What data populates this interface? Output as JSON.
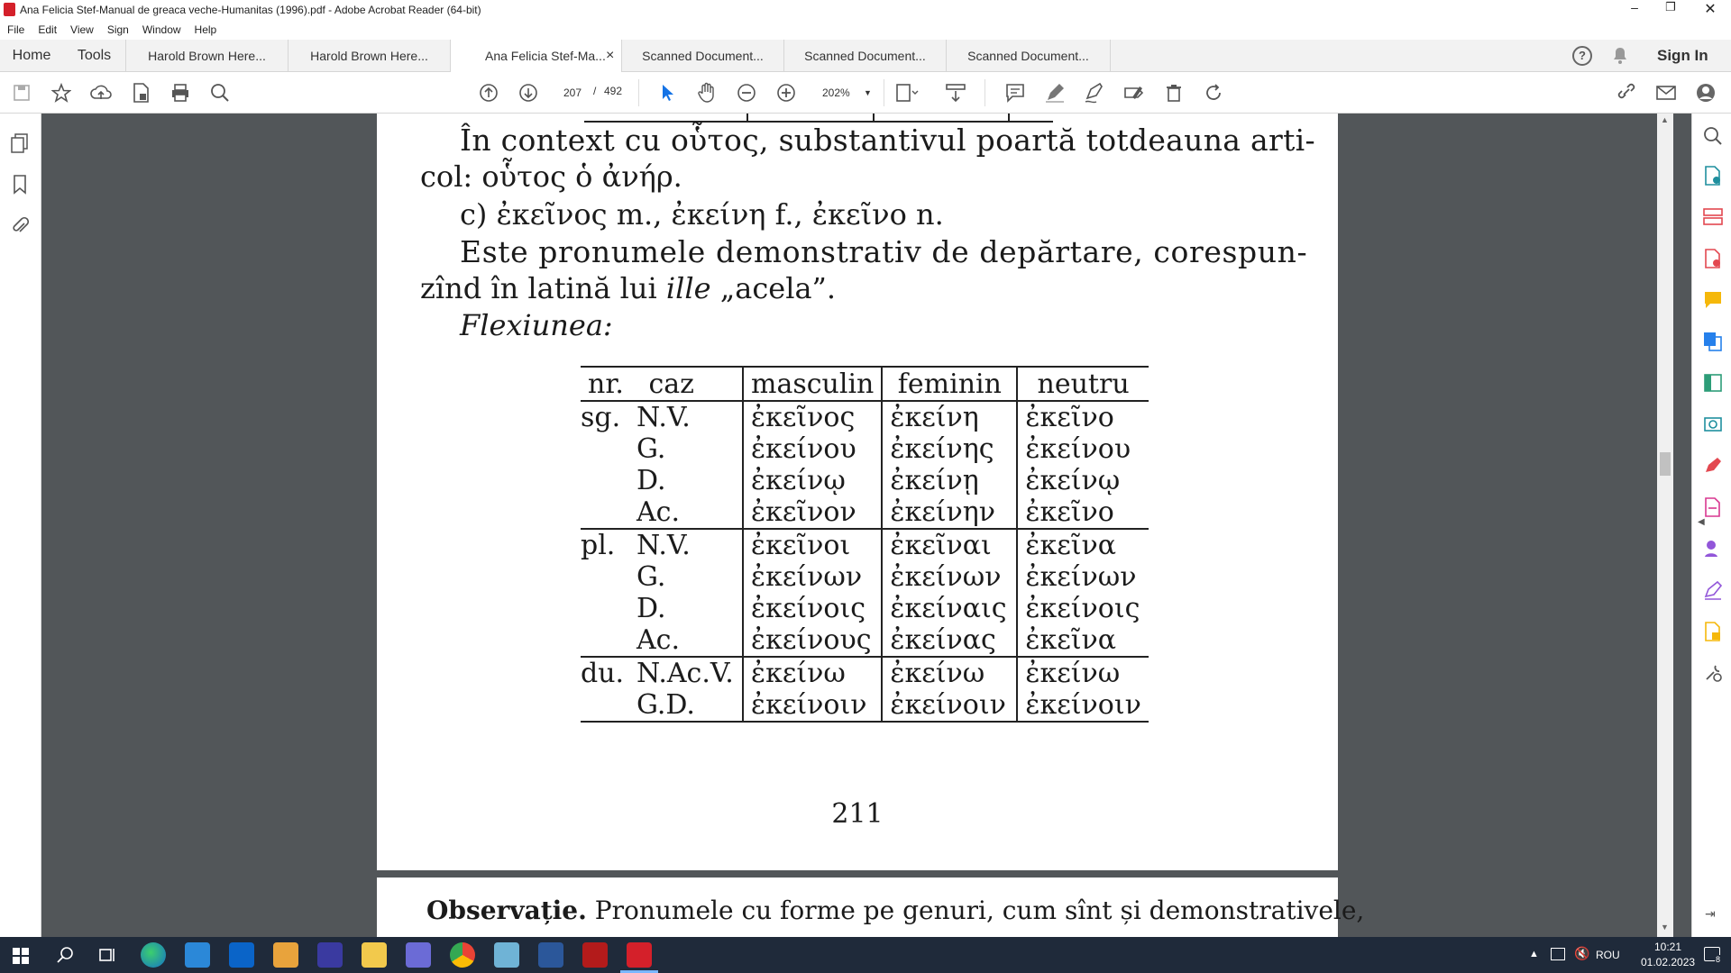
{
  "window": {
    "title": "Ana Felicia Stef-Manual de greaca veche-Humanitas (1996).pdf - Adobe Acrobat Reader (64-bit)"
  },
  "menu": [
    "File",
    "Edit",
    "View",
    "Sign",
    "Window",
    "Help"
  ],
  "tabs": {
    "home": "Home",
    "tools": "Tools",
    "docs": [
      "Harold Brown Here...",
      "Harold Brown Here...",
      "Ana Felicia Stef-Ma...",
      "Scanned Document...",
      "Scanned Document...",
      "Scanned Document..."
    ],
    "active_index": 2,
    "close": "×"
  },
  "header": {
    "sign_in": "Sign In"
  },
  "toolbar": {
    "page_current": "207",
    "page_sep": "/",
    "page_total": "492",
    "zoom": "202%"
  },
  "page": {
    "line1": "În context cu οὗτος, substantivul poartă totdeauna arti-",
    "line2": "col: οὗτος ὁ ἀνήρ.",
    "line3": "c) ἐκεῖνος m., ἐκείνη f., ἐκεῖνο n.",
    "line4_a": "Este pronumele demonstrativ de depărtare, corespun-",
    "line5_a": "zînd în latină lui ",
    "line5_i": "ille",
    "line5_b": " „acela”.",
    "line6": "Flexiunea:",
    "table": {
      "headers": [
        "nr. caz",
        "masculin",
        "feminin",
        "neutru"
      ],
      "groups": [
        {
          "nr": "sg.",
          "rows": [
            [
              "N.V.",
              "ἐκεῖνος",
              "ἐκείνη",
              "ἐκεῖνο"
            ],
            [
              "G.",
              "ἐκείνου",
              "ἐκείνης",
              "ἐκείνου"
            ],
            [
              "D.",
              "ἐκείνῳ",
              "ἐκείνῃ",
              "ἐκείνῳ"
            ],
            [
              "Ac.",
              "ἐκεῖνον",
              "ἐκείνην",
              "ἐκεῖνο"
            ]
          ]
        },
        {
          "nr": "pl.",
          "rows": [
            [
              "N.V.",
              "ἐκεῖνοι",
              "ἐκεῖναι",
              "ἐκεῖνα"
            ],
            [
              "G.",
              "ἐκείνων",
              "ἐκείνων",
              "ἐκείνων"
            ],
            [
              "D.",
              "ἐκείνοις",
              "ἐκείναις",
              "ἐκείνοις"
            ],
            [
              "Ac.",
              "ἐκείνους",
              "ἐκείνας",
              "ἐκεῖνα"
            ]
          ]
        },
        {
          "nr": "du.",
          "rows": [
            [
              "N.Ac.V.",
              "ἐκείνω",
              "ἐκείνω",
              "ἐκείνω"
            ],
            [
              "G.D.",
              "ἐκείνοιν",
              "ἐκείνοιν",
              "ἐκείνοιν"
            ]
          ]
        }
      ]
    },
    "page_number": "211",
    "next_bold": "Observație.",
    "next_text": " Pronumele cu forme pe genuri, cum sînt și demonstrativele,"
  },
  "taskbar": {
    "lang": "ROU",
    "time": "10:21",
    "date": "01.02.2023",
    "notif": "8"
  }
}
